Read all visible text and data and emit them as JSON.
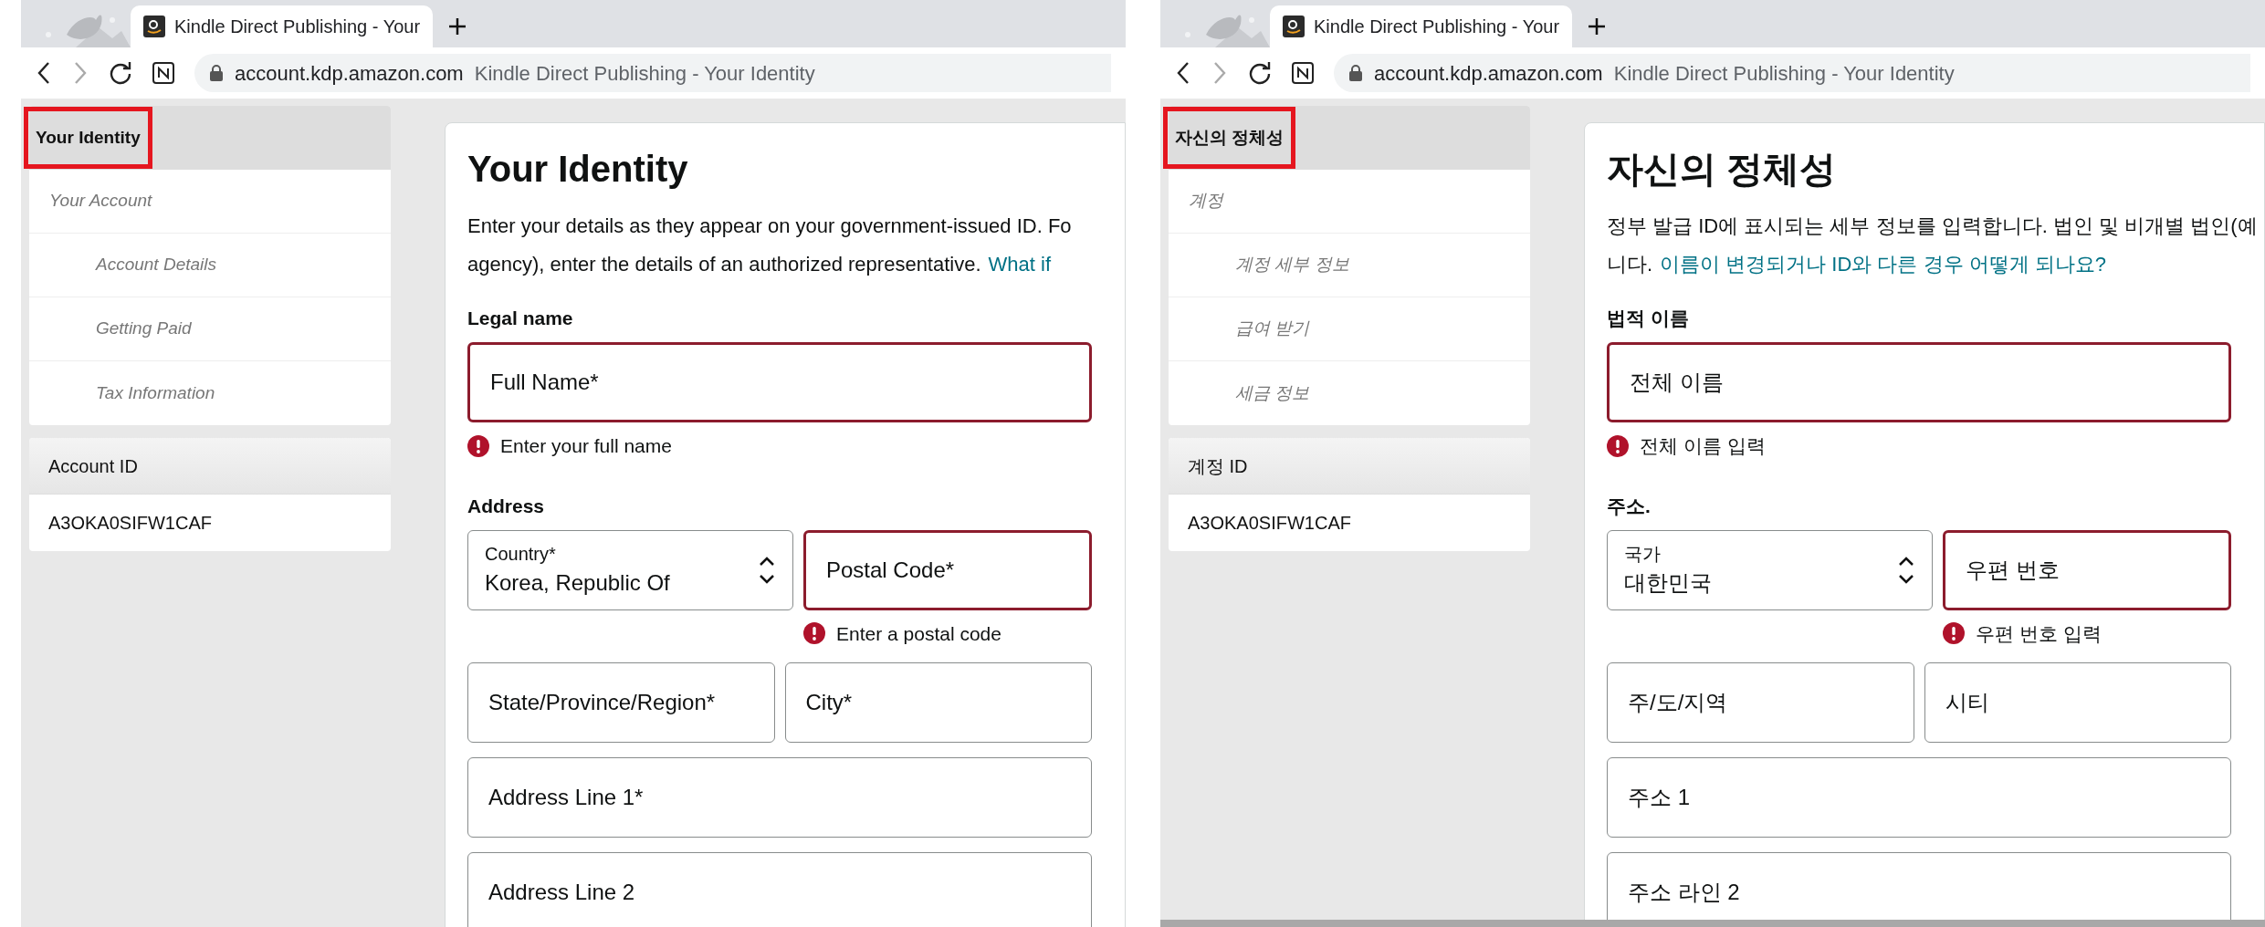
{
  "panes": [
    {
      "browser": {
        "tab_title": "Kindle Direct Publishing - Your",
        "url_domain": "account.kdp.amazon.com",
        "page_title": "Kindle Direct Publishing - Your Identity"
      },
      "sidebar": {
        "header": {
          "label": "Your Identity",
          "highlighted": true
        },
        "items": [
          {
            "label": "Your Account",
            "children": [
              {
                "label": "Account Details"
              },
              {
                "label": "Getting Paid"
              },
              {
                "label": "Tax Information"
              }
            ]
          }
        ],
        "account_id": {
          "label": "Account ID",
          "value": "A3OKA0SIFW1CAF"
        }
      },
      "form": {
        "title": "Your Identity",
        "intro": [
          {
            "text": "Enter your details as they appear on your government-issued ID. Fo"
          },
          {
            "text": "agency), enter the details of an authorized representative.",
            "link": "What if"
          }
        ],
        "sections": [
          {
            "label": "Legal name",
            "rows": [
              [
                {
                  "kind": "text",
                  "placeholder": "Full Name*",
                  "error": true,
                  "error_message": "Enter your full name"
                }
              ]
            ]
          },
          {
            "label": "Address",
            "rows": [
              [
                {
                  "kind": "select",
                  "label": "Country*",
                  "value": "Korea, Republic Of"
                },
                {
                  "kind": "text",
                  "placeholder": "Postal Code*",
                  "error": true,
                  "error_message": "Enter a postal code"
                }
              ],
              [
                {
                  "kind": "text",
                  "placeholder": "State/Province/Region*",
                  "error": false
                },
                {
                  "kind": "text",
                  "placeholder": "City*",
                  "error": false
                }
              ],
              [
                {
                  "kind": "text",
                  "placeholder": "Address Line 1*",
                  "error": false
                }
              ],
              [
                {
                  "kind": "text",
                  "placeholder": "Address Line 2",
                  "error": false
                }
              ]
            ]
          }
        ]
      }
    },
    {
      "browser": {
        "tab_title": "Kindle Direct Publishing - Your",
        "url_domain": "account.kdp.amazon.com",
        "page_title": "Kindle Direct Publishing - Your Identity"
      },
      "sidebar": {
        "header": {
          "label": "자신의 정체성",
          "highlighted": true
        },
        "items": [
          {
            "label": "계정",
            "children": [
              {
                "label": "계정 세부 정보"
              },
              {
                "label": "급여 받기"
              },
              {
                "label": "세금 정보"
              }
            ]
          }
        ],
        "account_id": {
          "label": "계정 ID",
          "value": "A3OKA0SIFW1CAF"
        }
      },
      "form": {
        "title": "자신의 정체성",
        "intro": [
          {
            "text": "정부 발급 ID에 표시되는 세부 정보를 입력합니다. 법인 및 비개별 법인(예"
          },
          {
            "text": "니다.",
            "link": "이름이 변경되거나 ID와 다른 경우 어떻게 되나요?"
          }
        ],
        "sections": [
          {
            "label": "법적 이름",
            "rows": [
              [
                {
                  "kind": "text",
                  "placeholder": "전체 이름",
                  "error": true,
                  "error_message": "전체 이름 입력"
                }
              ]
            ]
          },
          {
            "label": "주소.",
            "rows": [
              [
                {
                  "kind": "select",
                  "label": "국가",
                  "value": "대한민국"
                },
                {
                  "kind": "text",
                  "placeholder": "우편 번호",
                  "error": true,
                  "error_message": "우편 번호 입력"
                }
              ],
              [
                {
                  "kind": "text",
                  "placeholder": "주/도/지역",
                  "error": false
                },
                {
                  "kind": "text",
                  "placeholder": "시티",
                  "error": false
                }
              ],
              [
                {
                  "kind": "text",
                  "placeholder": "주소 1",
                  "error": false
                }
              ],
              [
                {
                  "kind": "text",
                  "placeholder": "주소 라인 2",
                  "error": false
                }
              ]
            ]
          }
        ]
      },
      "horizontal_scrollbar": true
    }
  ]
}
